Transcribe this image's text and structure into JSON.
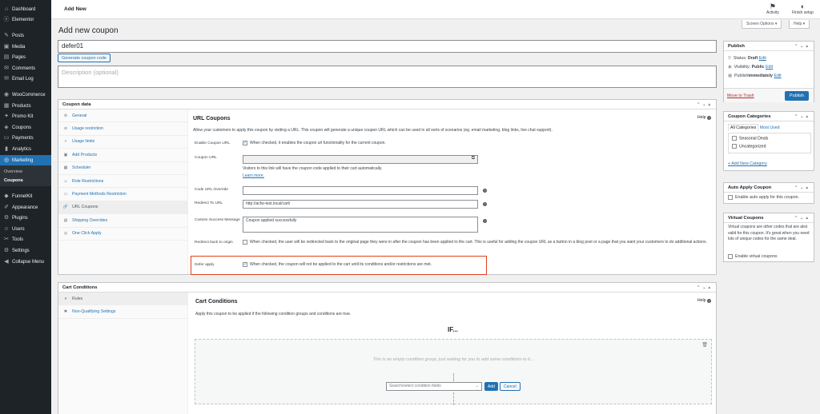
{
  "sidebar": {
    "items": [
      {
        "label": "Dashboard",
        "icon": "dashboard-icon",
        "glyph": "⌂"
      },
      {
        "label": "Elementor",
        "icon": "elementor-icon",
        "glyph": "ⓔ"
      },
      {
        "label": "Posts",
        "icon": "pin-icon",
        "glyph": "✎"
      },
      {
        "label": "Media",
        "icon": "media-icon",
        "glyph": "▣"
      },
      {
        "label": "Pages",
        "icon": "pages-icon",
        "glyph": "▤"
      },
      {
        "label": "Comments",
        "icon": "comments-icon",
        "glyph": "✉"
      },
      {
        "label": "Email Log",
        "icon": "email-icon",
        "glyph": "✉"
      },
      {
        "label": "WooCommerce",
        "icon": "woocommerce-icon",
        "glyph": "◉"
      },
      {
        "label": "Products",
        "icon": "products-icon",
        "glyph": "▦"
      },
      {
        "label": "Promo Kit",
        "icon": "promo-icon",
        "glyph": "✦"
      },
      {
        "label": "Coupons",
        "icon": "coupons-icon",
        "glyph": "◈"
      },
      {
        "label": "Payments",
        "icon": "payments-icon",
        "glyph": "▭"
      },
      {
        "label": "Analytics",
        "icon": "analytics-icon",
        "glyph": "▮"
      },
      {
        "label": "Marketing",
        "icon": "marketing-icon",
        "glyph": "◎"
      }
    ],
    "submenu": [
      "Overview",
      "Coupons"
    ],
    "items2": [
      {
        "label": "FunnelKit",
        "icon": "funnelkit-icon",
        "glyph": "◆"
      },
      {
        "label": "Appearance",
        "icon": "appearance-icon",
        "glyph": "✐"
      },
      {
        "label": "Plugins",
        "icon": "plugins-icon",
        "glyph": "⚙"
      },
      {
        "label": "Users",
        "icon": "users-icon",
        "glyph": "☺"
      },
      {
        "label": "Tools",
        "icon": "tools-icon",
        "glyph": "✂"
      },
      {
        "label": "Settings",
        "icon": "settings-icon",
        "glyph": "⚙"
      },
      {
        "label": "Collapse Menu",
        "icon": "collapse-icon",
        "glyph": "◀"
      }
    ]
  },
  "topbar": {
    "title": "Add New",
    "activity": "Activity",
    "finish": "Finish setup",
    "screen_options": "Screen Options ▾",
    "help": "Help ▾"
  },
  "page": {
    "title": "Add new coupon",
    "coupon_code": "defer01",
    "generate": "Generate coupon code",
    "description_placeholder": "Description (optional)"
  },
  "coupon_data": {
    "title": "Coupon data",
    "tabs": [
      "General",
      "Usage restriction",
      "Usage limits",
      "Add Products",
      "Scheduler",
      "Role Restrictions",
      "Payment Methods Restriction",
      "URL Coupons",
      "Shipping Overrides",
      "One Click Apply"
    ],
    "heading": "URL Coupons",
    "help": "Help",
    "intro": "Allow your customers to apply this coupon by visiting a URL. This coupon will generate a unique coupon URL which can be used in all sorts of scenarios (eg. email marketing, blog links, live chat support).",
    "enable_label": "Enable Coupon URL",
    "enable_text": "When checked, it enables the coupon url functionality for the current coupon.",
    "url_label": "Coupon URL",
    "url_help": "Visitors to this link will have the coupon code applied to their cart automatically.",
    "learn_more": "Learn more.",
    "override_label": "Code URL Override",
    "redirect_label": "Redirect To URL",
    "redirect_value": "http://acfw-test.local/cart/",
    "success_label": "Custom Success Message",
    "success_value": "Coupon applied successfully",
    "redirect_origin_label": "Redirect back to origin",
    "redirect_origin_text": "When checked, the user will be redirected back to the original page they were in after the coupon has been applied to the cart. This is useful for adding the coupon URL as a button in a blog post or a page that you want your customers to do additional actions.",
    "defer_label": "Defer apply",
    "defer_text": "When checked, the coupon will not be applied to the cart until its conditions and/or restrictions are met."
  },
  "cart_conditions": {
    "title": "Cart Conditions",
    "tabs": [
      "Rules",
      "Non-Qualifying Settings"
    ],
    "heading": "Cart Conditions",
    "help": "Help",
    "intro": "Apply this coupon to be applied if the following condition groups and conditions are true.",
    "if": "IF...",
    "empty": "This is an empty condition group, just waiting for you to add some conditions to it...",
    "search_placeholder": "Search/select condition fields",
    "add": "Add",
    "cancel": "Cancel"
  },
  "publish": {
    "title": "Publish",
    "status": "Status: ",
    "status_val": "Draft",
    "visibility": "Visibility: ",
    "visibility_val": "Public",
    "publish_line": "Publish ",
    "publish_val": "immediately",
    "edit": "Edit",
    "trash": "Move to Trash",
    "button": "Publish"
  },
  "categories": {
    "title": "Coupon Categories",
    "tab_all": "All Categories",
    "tab_used": "Most Used",
    "items": [
      "Seasonal Deals",
      "Uncategorized"
    ],
    "add": "+ Add New Category"
  },
  "auto_apply": {
    "title": "Auto Apply Coupon",
    "text": "Enable auto apply for this coupon."
  },
  "virtual": {
    "title": "Virtual Coupons",
    "text": "Virtual coupons are other codes that are also valid for this coupon. It's great when you need lots of unique codes for the same deal.",
    "checkbox": "Enable virtual coupons"
  }
}
